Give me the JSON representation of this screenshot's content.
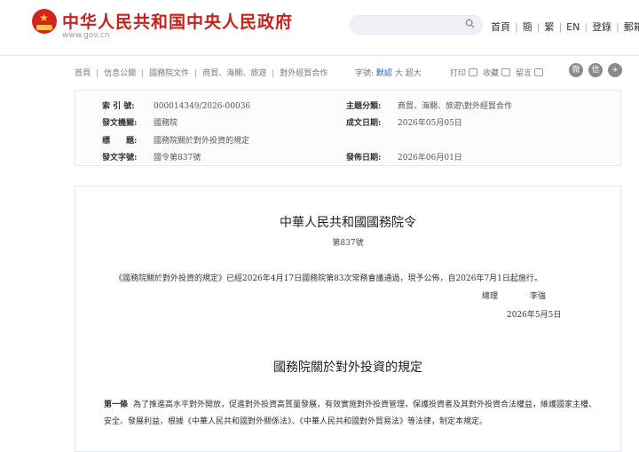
{
  "header": {
    "site_title": "中华人民共和国中央人民政府",
    "site_url": "www.gov.cn",
    "search_placeholder": "",
    "links": [
      "首頁",
      "簡",
      "繁",
      "EN",
      "登錄",
      "郵箱"
    ]
  },
  "breadcrumb": {
    "items": [
      "首頁",
      "信息公開",
      "國務院文件",
      "商貿、海關、旅遊",
      "對外經貿合作"
    ]
  },
  "font_size": {
    "label": "字號:",
    "options": [
      "默認",
      "大",
      "超大"
    ]
  },
  "actions": {
    "print": "打印",
    "favorite": "收藏",
    "comment": "留言"
  },
  "share_icons": [
    "weibo-icon",
    "wechat-icon",
    "more-icon"
  ],
  "meta": {
    "index_label": "索 引 號:",
    "index_value": "000014349/2026-00036",
    "topic_label": "主題分類:",
    "topic_value": "商貿、海關、旅遊\\對外經貿合作",
    "issuer_label": "發文機關:",
    "issuer_value": "國務院",
    "date_label": "成文日期:",
    "date_value": "2026年05月05日",
    "title_label": "標　　題:",
    "title_value": "國務院關於對外投資的規定",
    "docno_label": "發文字號:",
    "docno_value": "國令第837號",
    "pub_label": "發佈日期:",
    "pub_value": "2026年06月01日"
  },
  "article": {
    "order_title": "中華人民共和國國務院令",
    "order_no": "第837號",
    "intro": "《國務院關於對外投資的規定》已經2026年4月17日國務院第83次常務會議通過，現予公佈，自2026年7月1日起施行。",
    "signer_role": "總理",
    "signer_name": "李強",
    "sign_date": "2026年5月5日",
    "reg_title": "國務院關於對外投資的規定",
    "para1_lead": "第一條",
    "para1_text": "為了推進高水平對外開放，促進對外投資高質量發展，有效實施對外投資管理，保護投資者及其對外投資合法權益，維護國家主權、安全、發展利益，根據《中華人民共和國對外關係法》、《中華人民共和國對外貿易法》等法律，制定本規定。"
  },
  "colors": {
    "brand_red": "#c4231b",
    "link_blue": "#1a5fb4"
  }
}
